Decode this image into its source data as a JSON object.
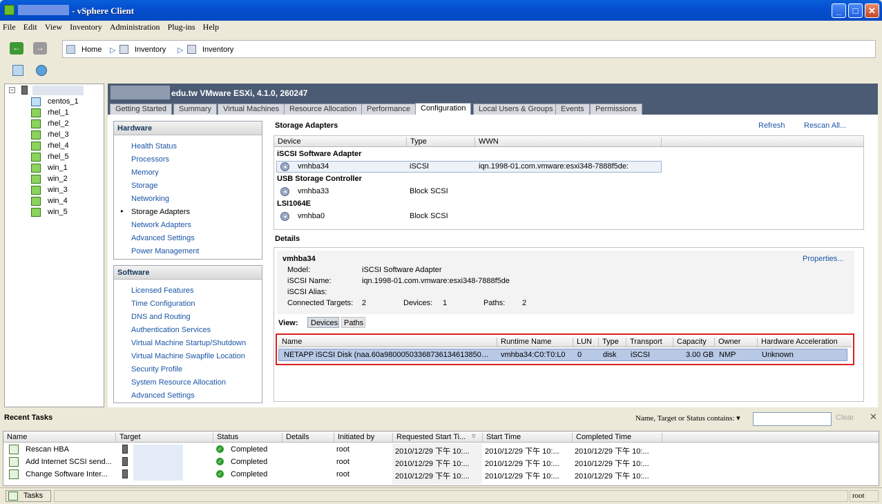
{
  "window": {
    "title": "- vSphere Client"
  },
  "menu": [
    "File",
    "Edit",
    "View",
    "Inventory",
    "Administration",
    "Plug-ins",
    "Help"
  ],
  "nav": {
    "breadcrumbs": [
      "Home",
      "Inventory",
      "Inventory"
    ]
  },
  "tree": {
    "vms": [
      "centos_1",
      "rhel_1",
      "rhel_2",
      "rhel_3",
      "rhel_4",
      "rhel_5",
      "win_1",
      "win_2",
      "win_3",
      "win_4",
      "win_5"
    ]
  },
  "host": {
    "title": "edu.tw VMware ESXi, 4.1.0, 260247",
    "tabs": [
      "Getting Started",
      "Summary",
      "Virtual Machines",
      "Resource Allocation",
      "Performance",
      "Configuration",
      "Local Users & Groups",
      "Events",
      "Permissions"
    ],
    "active_tab": "Configuration"
  },
  "hardware": {
    "title": "Hardware",
    "items": [
      "Health Status",
      "Processors",
      "Memory",
      "Storage",
      "Networking",
      "Storage Adapters",
      "Network Adapters",
      "Advanced Settings",
      "Power Management"
    ],
    "selected": "Storage Adapters"
  },
  "software": {
    "title": "Software",
    "items": [
      "Licensed Features",
      "Time Configuration",
      "DNS and Routing",
      "Authentication Services",
      "Virtual Machine Startup/Shutdown",
      "Virtual Machine Swapfile Location",
      "Security Profile",
      "System Resource Allocation",
      "Advanced Settings"
    ]
  },
  "adapters": {
    "title": "Storage Adapters",
    "refresh": "Refresh",
    "rescan": "Rescan All...",
    "columns": [
      "Device",
      "Type",
      "WWN"
    ],
    "groups": [
      {
        "name": "iSCSI Software Adapter",
        "device": "vmhba34",
        "type": "iSCSI",
        "wwn": "iqn.1998-01.com.vmware:esxi348-7888f5de:"
      },
      {
        "name": "USB Storage Controller",
        "device": "vmhba33",
        "type": "Block SCSI",
        "wwn": ""
      },
      {
        "name": "LSI1064E",
        "device": "vmhba0",
        "type": "Block SCSI",
        "wwn": ""
      }
    ]
  },
  "details": {
    "title": "Details",
    "name": "vmhba34",
    "properties": "Properties...",
    "model_label": "Model:",
    "model": "iSCSI Software Adapter",
    "iscsi_name_label": "iSCSI Name:",
    "iscsi_name": "iqn.1998-01.com.vmware:esxi348-7888f5de",
    "alias_label": "iSCSI Alias:",
    "targets_label": "Connected Targets:",
    "targets": "2",
    "devices_label": "Devices:",
    "devices": "1",
    "paths_label": "Paths:",
    "paths": "2",
    "view_label": "View:",
    "view_devices": "Devices",
    "view_paths": "Paths",
    "columns": [
      "Name",
      "Runtime Name",
      "LUN",
      "Type",
      "Transport",
      "Capacity",
      "Owner",
      "Hardware Acceleration"
    ],
    "row": [
      "NETAPP iSCSI Disk (naa.60a98000503368736134613850…",
      "vmhba34:C0:T0:L0",
      "0",
      "disk",
      "iSCSI",
      "3.00 GB",
      "NMP",
      "Unknown"
    ]
  },
  "tasks": {
    "title": "Recent Tasks",
    "filter_label": "Name, Target or Status contains: ▾",
    "clear": "Clear",
    "columns": [
      "Name",
      "Target",
      "Status",
      "Details",
      "Initiated by",
      "Requested Start Ti...",
      "Start Time",
      "Completed Time"
    ],
    "rows": [
      [
        "Rescan HBA",
        "Completed",
        "root",
        "2010/12/29 下午 10:...",
        "2010/12/29 下午 10:...",
        "2010/12/29 下午 10:..."
      ],
      [
        "Add Internet SCSI send...",
        "Completed",
        "root",
        "2010/12/29 下午 10:...",
        "2010/12/29 下午 10:...",
        "2010/12/29 下午 10:..."
      ],
      [
        "Change Software Inter...",
        "Completed",
        "root",
        "2010/12/29 下午 10:...",
        "2010/12/29 下午 10:...",
        "2010/12/29 下午 10:..."
      ]
    ]
  },
  "statusbar": {
    "tasks": "Tasks",
    "user": "root"
  }
}
